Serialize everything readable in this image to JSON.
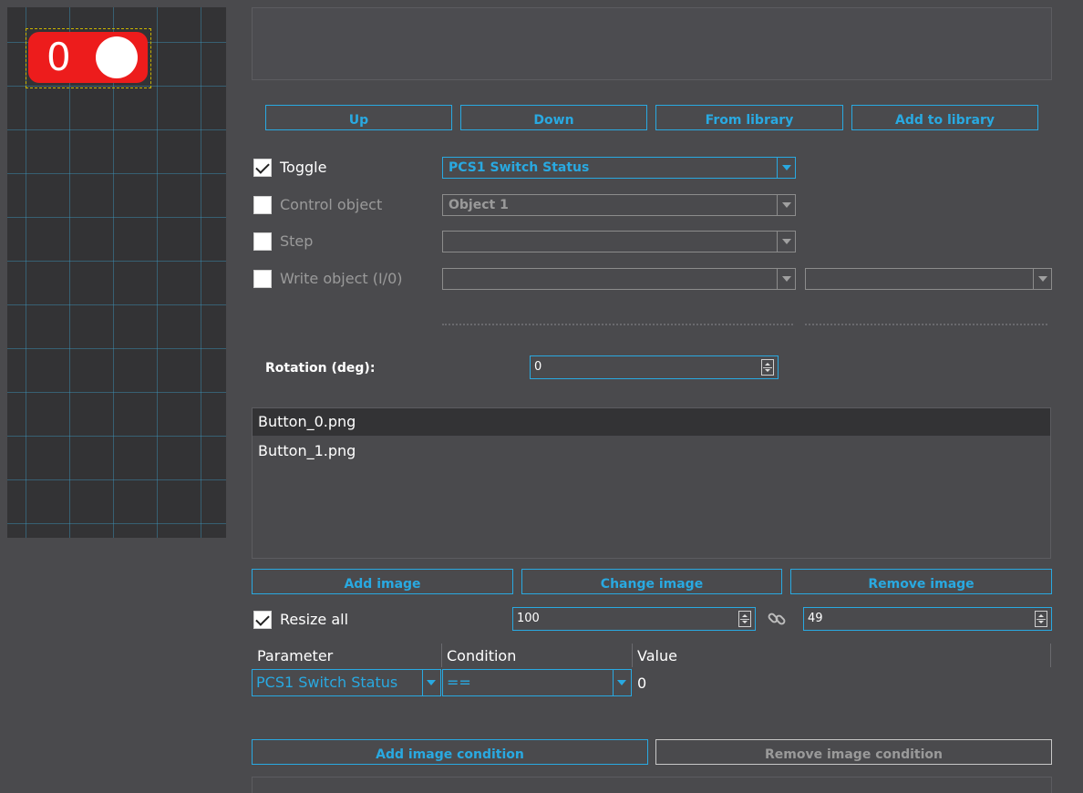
{
  "canvas": {
    "toggle_value": "0",
    "toggle_color": "#ed1c1c"
  },
  "image_nav_buttons": {
    "up": "Up",
    "down": "Down",
    "from_library": "From library",
    "add_to_library": "Add to library"
  },
  "options": {
    "toggle": {
      "label": "Toggle",
      "checked": true,
      "value": "PCS1 Switch Status"
    },
    "control_object": {
      "label": "Control object",
      "checked": false,
      "value": "Object 1"
    },
    "step": {
      "label": "Step",
      "checked": false,
      "value": ""
    },
    "write_object": {
      "label": "Write object (I/0)",
      "checked": false,
      "value1": "",
      "value2": ""
    }
  },
  "rotation": {
    "label": "Rotation (deg):",
    "value": "0"
  },
  "images": {
    "items": [
      "Button_0.png",
      "Button_1.png"
    ],
    "selected": "Button_0.png"
  },
  "image_buttons": {
    "add": "Add image",
    "change": "Change image",
    "remove": "Remove image"
  },
  "resize": {
    "label": "Resize all",
    "checked": true,
    "width": "100",
    "height": "49"
  },
  "conditions": {
    "headers": [
      "Parameter",
      "Condition",
      "Value"
    ],
    "rows": [
      {
        "parameter": "PCS1 Switch Status",
        "condition": "==",
        "value": "0"
      }
    ]
  },
  "condition_buttons": {
    "add": "Add image condition",
    "remove": "Remove image condition"
  },
  "colors": {
    "accent": "#29a9e1",
    "background": "#4a4a4d",
    "grid_background": "#333335"
  }
}
